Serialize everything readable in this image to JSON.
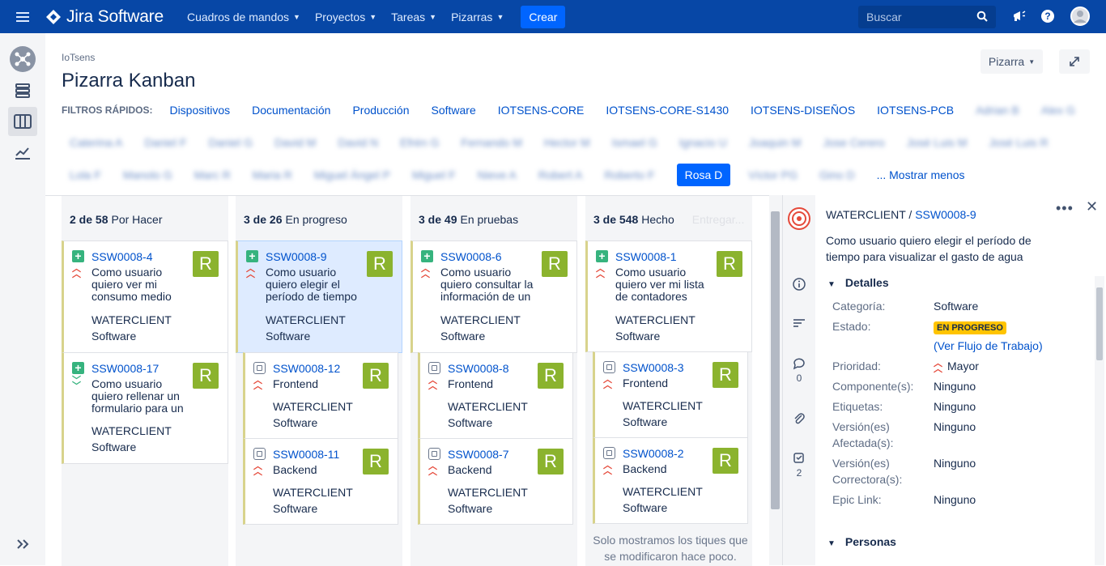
{
  "topnav": {
    "product": "Jira Software",
    "menu": [
      "Cuadros de mandos",
      "Proyectos",
      "Tareas",
      "Pizarras"
    ],
    "create": "Crear",
    "search_placeholder": "Buscar"
  },
  "header": {
    "project": "IoTsens",
    "title": "Pizarra Kanban",
    "board_button": "Pizarra"
  },
  "filters": {
    "label": "FILTROS RÁPIDOS:",
    "row1": [
      "Dispositivos",
      "Documentación",
      "Producción",
      "Software",
      "IOTSENS-CORE",
      "IOTSENS-CORE-S1430",
      "IOTSENS-DISEÑOS",
      "IOTSENS-PCB",
      "Adrian B",
      "Alex G"
    ],
    "row2": [
      "Caterina A",
      "Daniel F",
      "Daniel G",
      "David M",
      "David N",
      "Efrén G",
      "Fernando M",
      "Hector M",
      "Ismael G",
      "Ignacio U",
      "Joaquin M",
      "Jose Cerero",
      "José Luis M",
      "José Luis R"
    ],
    "row3": [
      "Lola F",
      "Manolo G",
      "Marc R",
      "Maria R",
      "Miguel Ángel P",
      "Miguel F",
      "Nieve A",
      "Robert A",
      "Roberto F"
    ],
    "active": "Rosa D",
    "after_active": [
      "Víctor PG",
      "Gino D"
    ],
    "show_less": "... Mostrar menos"
  },
  "columns": [
    {
      "count": "2 de 58",
      "name": "Por Hacer",
      "extra": ""
    },
    {
      "count": "3 de 26",
      "name": "En progreso",
      "extra": ""
    },
    {
      "count": "3 de 49",
      "name": "En pruebas",
      "extra": ""
    },
    {
      "count": "3 de 548",
      "name": "Hecho",
      "extra": "Entregar..."
    }
  ],
  "cards": {
    "c1": {
      "key": "SSW0008-4",
      "summary": "Como usuario quiero ver mi consumo medio",
      "epic1": "WATERCLIENT",
      "epic2": "Software",
      "avatar": "R"
    },
    "c2": {
      "key": "SSW0008-17",
      "summary": "Como usuario quiero rellenar un formulario para un",
      "epic1": "WATERCLIENT",
      "epic2": "Software",
      "avatar": "R"
    },
    "c3": {
      "key": "SSW0008-9",
      "summary": "Como usuario quiero elegir el período de tiempo",
      "epic1": "WATERCLIENT",
      "epic2": "Software",
      "avatar": "R"
    },
    "c4": {
      "key": "SSW0008-12",
      "summary": "Frontend",
      "epic1": "WATERCLIENT",
      "epic2": "Software",
      "avatar": "R"
    },
    "c5": {
      "key": "SSW0008-11",
      "summary": "Backend",
      "epic1": "WATERCLIENT",
      "epic2": "Software",
      "avatar": "R"
    },
    "c6": {
      "key": "SSW0008-6",
      "summary": "Como usuario quiero consultar la información de un",
      "epic1": "WATERCLIENT",
      "epic2": "Software",
      "avatar": "R"
    },
    "c7": {
      "key": "SSW0008-8",
      "summary": "Frontend",
      "epic1": "WATERCLIENT",
      "epic2": "Software",
      "avatar": "R"
    },
    "c8": {
      "key": "SSW0008-7",
      "summary": "Backend",
      "epic1": "WATERCLIENT",
      "epic2": "Software",
      "avatar": "R"
    },
    "c9": {
      "key": "SSW0008-1",
      "summary": "Como usuario quiero ver mi lista de contadores",
      "epic1": "WATERCLIENT",
      "epic2": "Software",
      "avatar": "R"
    },
    "c10": {
      "key": "SSW0008-3",
      "summary": "Frontend",
      "epic1": "WATERCLIENT",
      "epic2": "Software",
      "avatar": "R"
    },
    "c11": {
      "key": "SSW0008-2",
      "summary": "Backend",
      "epic1": "WATERCLIENT",
      "epic2": "Software",
      "avatar": "R"
    }
  },
  "done_note": "Solo mostramos los tiques que se modificaron hace poco.",
  "detail": {
    "parent": "WATERCLIENT",
    "sep": "/",
    "key": "SSW0008-9",
    "summary": "Como usuario quiero elegir el período de tiempo para visualizar el gasto de agua",
    "section_details": "Detalles",
    "section_people": "Personas",
    "comments_count": "0",
    "subtasks_count": "2",
    "fields": {
      "category_label": "Categoría:",
      "category": "Software",
      "status_label": "Estado:",
      "status": "EN PROGRESO",
      "workflow": "(Ver Flujo de Trabajo)",
      "priority_label": "Prioridad:",
      "priority": "Mayor",
      "component_label": "Componente(s):",
      "component": "Ninguno",
      "labels_label": "Etiquetas:",
      "labels": "Ninguno",
      "affected_label1": "Versión(es)",
      "affected_label2": "Afectada(s):",
      "affected": "Ninguno",
      "fix_label1": "Versión(es)",
      "fix_label2": "Correctora(s):",
      "fix": "Ninguno",
      "epic_label": "Epic Link:",
      "epic": "Ninguno"
    }
  },
  "colors": {
    "nav": "#0747a6",
    "create": "#0065ff",
    "status": "#ffc400",
    "avatar": "#8bb32e"
  }
}
